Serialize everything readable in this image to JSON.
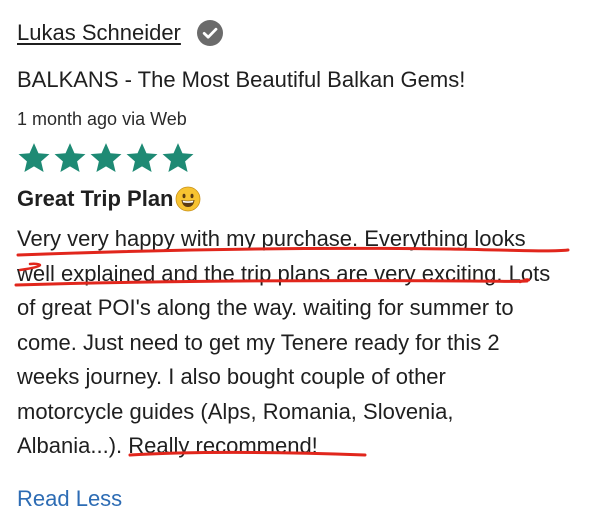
{
  "review": {
    "author_name": "Lukas Schneider",
    "trip_title": "BALKANS - The Most Beautiful Balkan Gems!",
    "meta": "1 month ago via Web",
    "rating": 5,
    "rating_max": 5,
    "headline": "Great Trip Plan",
    "headline_emoji": "grinning-face-emoji",
    "body_lines": [
      "Very very happy with my purchase. Everything looks",
      "well explained and the trip plans are very exciting. Lots",
      "of great POI's along the way. waiting for summer to",
      "come. Just need to get my Tenere ready for this 2",
      "weeks journey. I also bought couple of other",
      "motorcycle guides (Alps, Romania, Slovenia,",
      "Albania...). Really recommend!"
    ],
    "read_less_label": "Read Less"
  },
  "icons": {
    "verified": "check-circle-icon",
    "star": "star-icon"
  },
  "colors": {
    "star": "#1e8a74",
    "link": "#2d6cb4",
    "annotation": "#e1261c",
    "verified_badge": "#6b6b6b"
  }
}
